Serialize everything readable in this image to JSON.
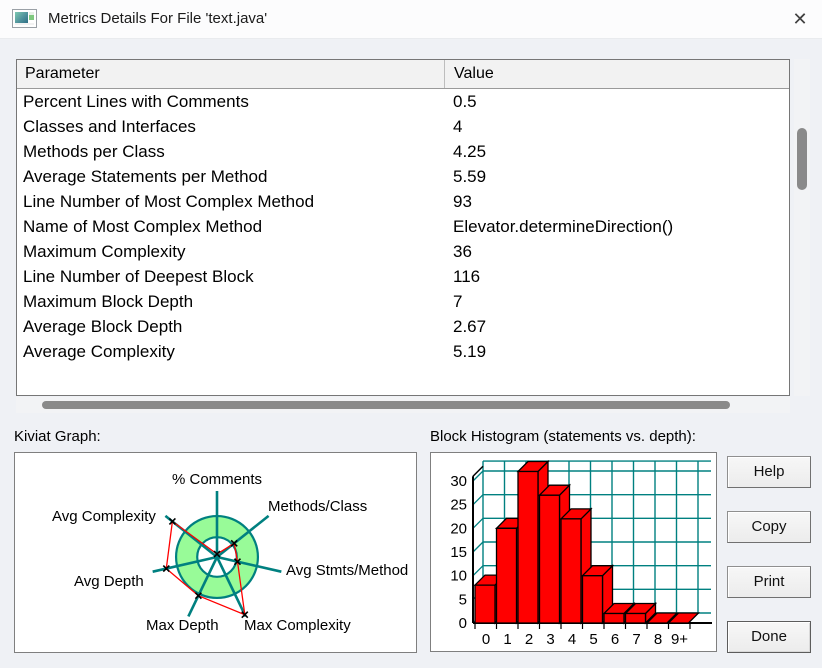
{
  "window": {
    "title": "Metrics Details For File 'text.java'",
    "close_glyph": "✕"
  },
  "table": {
    "columns": [
      "Parameter",
      "Value"
    ],
    "rows": [
      {
        "parameter": "Percent Lines with Comments",
        "value": "0.5"
      },
      {
        "parameter": "Classes and Interfaces",
        "value": "4"
      },
      {
        "parameter": "Methods per Class",
        "value": "4.25"
      },
      {
        "parameter": "Average Statements per Method",
        "value": "5.59"
      },
      {
        "parameter": "Line Number of Most Complex Method",
        "value": "93"
      },
      {
        "parameter": "Name of Most Complex Method",
        "value": "Elevator.determineDirection()"
      },
      {
        "parameter": "Maximum Complexity",
        "value": "36"
      },
      {
        "parameter": "Line Number of Deepest Block",
        "value": "116"
      },
      {
        "parameter": "Maximum Block Depth",
        "value": "7"
      },
      {
        "parameter": "Average Block Depth",
        "value": "2.67"
      },
      {
        "parameter": "Average Complexity",
        "value": "5.19"
      }
    ]
  },
  "sections": {
    "kiviat_label": "Kiviat Graph:",
    "histogram_label": "Block Histogram (statements vs. depth):"
  },
  "buttons": {
    "help": "Help",
    "copy": "Copy",
    "print": "Print",
    "done": "Done"
  },
  "colors": {
    "teal": "#008080",
    "kiviat_ring_green": "#98FB98",
    "series_red": "#FF0000",
    "outline_black": "#000000"
  },
  "chart_data": [
    {
      "type": "radar",
      "title": "Kiviat Graph",
      "axes": [
        "% Comments",
        "Methods/Class",
        "Avg Stmts/Method",
        "Max Complexity",
        "Max Depth",
        "Avg Depth",
        "Avg Complexity"
      ],
      "metric_values": [
        0.5,
        4.25,
        5.59,
        36,
        7,
        2.67,
        5.19
      ],
      "normalized_radii": [
        0.045,
        0.333,
        0.318,
        0.97,
        0.65,
        0.788,
        0.864
      ],
      "ring_inner": 0.3,
      "ring_outer": 0.62,
      "legend_position": "none",
      "grid": "spokes-and-ring"
    },
    {
      "type": "bar",
      "title": "Block Histogram (statements vs. depth)",
      "categories": [
        "0",
        "1",
        "2",
        "3",
        "4",
        "5",
        "6",
        "7",
        "8",
        "9+"
      ],
      "values": [
        8,
        20,
        32,
        27,
        22,
        10,
        2,
        2,
        0,
        0
      ],
      "y_ticks": [
        0,
        5,
        10,
        15,
        20,
        25,
        30
      ],
      "ylim": [
        0,
        34
      ],
      "xlabel": "",
      "ylabel": "",
      "grid": "teal-3d-grid",
      "style": "red-3d-blocks"
    }
  ]
}
